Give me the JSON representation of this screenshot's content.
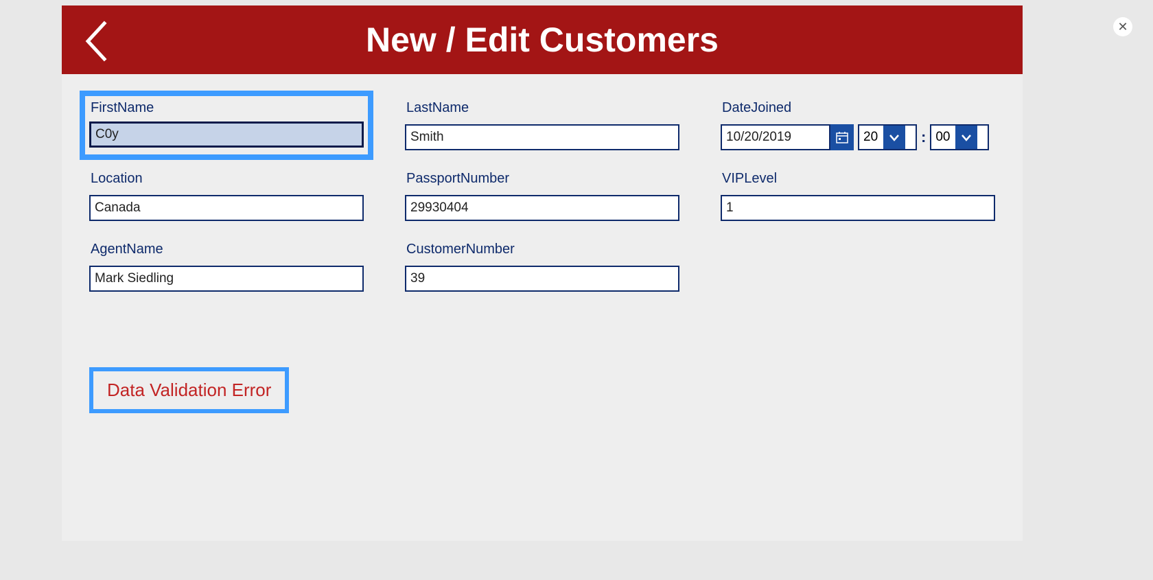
{
  "header": {
    "title": "New / Edit Customers"
  },
  "fields": {
    "firstName": {
      "label": "FirstName",
      "value": "C0y"
    },
    "lastName": {
      "label": "LastName",
      "value": "Smith"
    },
    "dateJoined": {
      "label": "DateJoined",
      "date": "10/20/2019",
      "hours": "20",
      "minutes": "00",
      "separator": ":"
    },
    "location": {
      "label": "Location",
      "value": "Canada"
    },
    "passportNumber": {
      "label": "PassportNumber",
      "value": "29930404"
    },
    "vipLevel": {
      "label": "VIPLevel",
      "value": "1"
    },
    "agentName": {
      "label": "AgentName",
      "value": "Mark Siedling"
    },
    "customerNumber": {
      "label": "CustomerNumber",
      "value": "39"
    }
  },
  "error": {
    "message": "Data Validation Error"
  }
}
